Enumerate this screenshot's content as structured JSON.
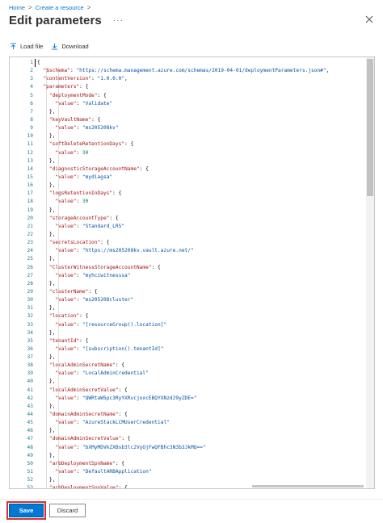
{
  "breadcrumb": {
    "items": [
      "Home",
      "Create a resource"
    ],
    "separator": ">"
  },
  "header": {
    "title": "Edit parameters",
    "more_label": "···"
  },
  "toolbar": {
    "load_label": "Load file",
    "download_label": "Download"
  },
  "editor": {
    "line_numbers": [
      "1",
      "2",
      "3",
      "4",
      "5",
      "6",
      "7",
      "8",
      "9",
      "10",
      "11",
      "12",
      "13",
      "14",
      "15",
      "16",
      "17",
      "18",
      "19",
      "20",
      "21",
      "22",
      "23",
      "24",
      "25",
      "26",
      "27",
      "28",
      "29",
      "30",
      "31",
      "32",
      "33",
      "34",
      "35",
      "36",
      "37",
      "38",
      "39",
      "40",
      "41",
      "42",
      "43",
      "44",
      "45",
      "46",
      "47",
      "48",
      "49",
      "50",
      "51",
      "52",
      "53"
    ],
    "lines": [
      [
        [
          "p",
          "{"
        ]
      ],
      [
        [
          "k",
          "  \"$schema\""
        ],
        [
          "p",
          ": "
        ],
        [
          "s",
          "\"https://schema.management.azure.com/schemas/2019-04-01/deploymentParameters.json#\""
        ],
        [
          "p",
          ","
        ]
      ],
      [
        [
          "k",
          "  \"contentVersion\""
        ],
        [
          "p",
          ": "
        ],
        [
          "s",
          "\"1.0.0.0\""
        ],
        [
          "p",
          ","
        ]
      ],
      [
        [
          "k",
          "  \"parameters\""
        ],
        [
          "p",
          ": {"
        ]
      ],
      [
        [
          "k",
          "    \"deploymentMode\""
        ],
        [
          "p",
          ": {"
        ]
      ],
      [
        [
          "k",
          "      \"value\""
        ],
        [
          "p",
          ": "
        ],
        [
          "s",
          "\"Validate\""
        ]
      ],
      [
        [
          "p",
          "    },"
        ]
      ],
      [
        [
          "k",
          "    \"keyVaultName\""
        ],
        [
          "p",
          ": {"
        ]
      ],
      [
        [
          "k",
          "      \"value\""
        ],
        [
          "p",
          ": "
        ],
        [
          "s",
          "\"ms205208kv\""
        ]
      ],
      [
        [
          "p",
          "    },"
        ]
      ],
      [
        [
          "k",
          "    \"softDeleteRetentionDays\""
        ],
        [
          "p",
          ": {"
        ]
      ],
      [
        [
          "k",
          "      \"value\""
        ],
        [
          "p",
          ": "
        ],
        [
          "n",
          "30"
        ]
      ],
      [
        [
          "p",
          "    },"
        ]
      ],
      [
        [
          "k",
          "    \"diagnosticStorageAccountName\""
        ],
        [
          "p",
          ": {"
        ]
      ],
      [
        [
          "k",
          "      \"value\""
        ],
        [
          "p",
          ": "
        ],
        [
          "s",
          "\"mydiagsa\""
        ]
      ],
      [
        [
          "p",
          "    },"
        ]
      ],
      [
        [
          "k",
          "    \"logsRetentionInDays\""
        ],
        [
          "p",
          ": {"
        ]
      ],
      [
        [
          "k",
          "      \"value\""
        ],
        [
          "p",
          ": "
        ],
        [
          "n",
          "30"
        ]
      ],
      [
        [
          "p",
          "    },"
        ]
      ],
      [
        [
          "k",
          "    \"storageAccountType\""
        ],
        [
          "p",
          ": {"
        ]
      ],
      [
        [
          "k",
          "      \"value\""
        ],
        [
          "p",
          ": "
        ],
        [
          "s",
          "\"Standard_LRS\""
        ]
      ],
      [
        [
          "p",
          "    },"
        ]
      ],
      [
        [
          "k",
          "    \"secretsLocation\""
        ],
        [
          "p",
          ": {"
        ]
      ],
      [
        [
          "k",
          "      \"value\""
        ],
        [
          "p",
          ": "
        ],
        [
          "s",
          "\"https://ms205208kv.vault.azure.net/\""
        ]
      ],
      [
        [
          "p",
          "    },"
        ]
      ],
      [
        [
          "k",
          "    \"ClusterWitnessStorageAccountName\""
        ],
        [
          "p",
          ": {"
        ]
      ],
      [
        [
          "k",
          "      \"value\""
        ],
        [
          "p",
          ": "
        ],
        [
          "s",
          "\"myhciwitnesssa\""
        ]
      ],
      [
        [
          "p",
          "    },"
        ]
      ],
      [
        [
          "k",
          "    \"clusterName\""
        ],
        [
          "p",
          ": {"
        ]
      ],
      [
        [
          "k",
          "      \"value\""
        ],
        [
          "p",
          ": "
        ],
        [
          "s",
          "\"ms205208cluster\""
        ]
      ],
      [
        [
          "p",
          "    },"
        ]
      ],
      [
        [
          "k",
          "    \"location\""
        ],
        [
          "p",
          ": {"
        ]
      ],
      [
        [
          "k",
          "      \"value\""
        ],
        [
          "p",
          ": "
        ],
        [
          "s",
          "\"[resourceGroup().location]\""
        ]
      ],
      [
        [
          "p",
          "    },"
        ]
      ],
      [
        [
          "k",
          "    \"tenantId\""
        ],
        [
          "p",
          ": {"
        ]
      ],
      [
        [
          "k",
          "      \"value\""
        ],
        [
          "p",
          ": "
        ],
        [
          "s",
          "\"[subscription().tenantId]\""
        ]
      ],
      [
        [
          "p",
          "    },"
        ]
      ],
      [
        [
          "k",
          "    \"localAdminSecretName\""
        ],
        [
          "p",
          ": {"
        ]
      ],
      [
        [
          "k",
          "      \"value\""
        ],
        [
          "p",
          ": "
        ],
        [
          "s",
          "\"LocalAdminCredential\""
        ]
      ],
      [
        [
          "p",
          "    },"
        ]
      ],
      [
        [
          "k",
          "    \"localAdminSecretValue\""
        ],
        [
          "p",
          ": {"
        ]
      ],
      [
        [
          "k",
          "      \"value\""
        ],
        [
          "p",
          ": "
        ],
        [
          "s",
          "\"QWRtaW5pc3RyYXRvcjoxcEBQYXNzd29yZDE=\""
        ]
      ],
      [
        [
          "p",
          "    },"
        ]
      ],
      [
        [
          "k",
          "    \"domainAdminSecretName\""
        ],
        [
          "p",
          ": {"
        ]
      ],
      [
        [
          "k",
          "      \"value\""
        ],
        [
          "p",
          ": "
        ],
        [
          "s",
          "\"AzureStackLCMUserCredential\""
        ]
      ],
      [
        [
          "p",
          "    },"
        ]
      ],
      [
        [
          "k",
          "    \"domainAdminSecretValue\""
        ],
        [
          "p",
          ": {"
        ]
      ],
      [
        [
          "k",
          "      \"value\""
        ],
        [
          "p",
          ": "
        ],
        [
          "s",
          "\"bXMyMDVkZXBsb3lc2VyOjFwQFBhc3N3b3JkMQ==\""
        ]
      ],
      [
        [
          "p",
          "    },"
        ]
      ],
      [
        [
          "k",
          "    \"arbDeploymentSpnName\""
        ],
        [
          "p",
          ": {"
        ]
      ],
      [
        [
          "k",
          "      \"value\""
        ],
        [
          "p",
          ": "
        ],
        [
          "s",
          "\"DefaultARBApplication\""
        ]
      ],
      [
        [
          "p",
          "    },"
        ]
      ],
      [
        [
          "k",
          "    \"arbDeploymentSpnValue\""
        ],
        [
          "p",
          ": {"
        ]
      ]
    ]
  },
  "footer": {
    "save_label": "Save",
    "discard_label": "Discard"
  },
  "colors": {
    "accent": "#0078d4",
    "key": "#a31515",
    "string": "#0451a5",
    "number": "#098658",
    "line_number": "#237893"
  }
}
